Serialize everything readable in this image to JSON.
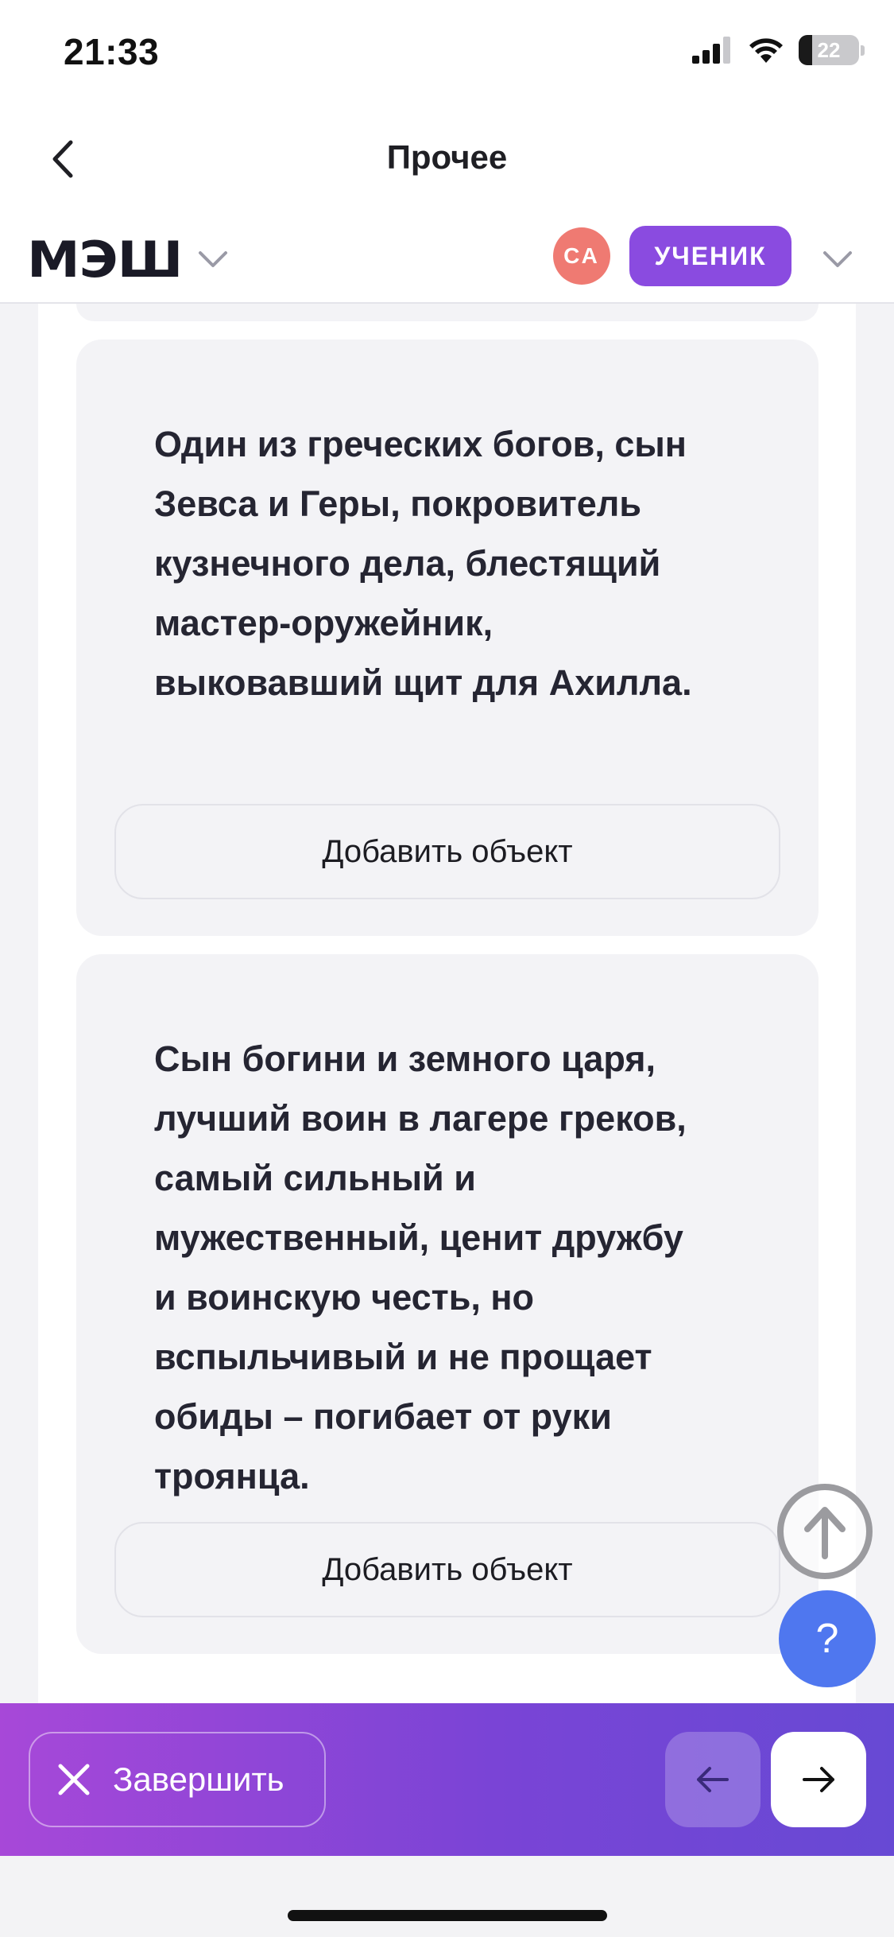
{
  "status_bar": {
    "time": "21:33",
    "battery_level": "22",
    "icons": [
      "cellular-signal-icon",
      "wifi-icon",
      "battery-icon"
    ]
  },
  "header": {
    "title": "Прочее",
    "back_icon": "chevron-left-icon"
  },
  "brand_bar": {
    "logo": "МЭШ",
    "avatar_initials": "СА",
    "role": "УЧЕНИК",
    "colors": {
      "avatar": "#ef7a72",
      "role_badge": "#8a4be0"
    }
  },
  "cards": [
    {
      "text": "Один из греческих богов, сын Зевса и Геры, покровитель кузнечного дела, блестящий мастер-оружейник, выковавший щит для Ахилла.",
      "button_label": "Добавить объект"
    },
    {
      "text": "Сын богини и земного царя, лучший воин в лагере греков, самый сильный и мужественный, ценит дружбу и воинскую честь, но вспыльчивый и не прощает обиды – погибает от руки троянца.",
      "button_label": "Добавить объект"
    }
  ],
  "floating": {
    "scroll_top_icon": "arrow-up-circle-icon",
    "help_label": "?"
  },
  "action_bar": {
    "finish_label": "Завершить",
    "colors": {
      "gradient_start": "#a748d8",
      "gradient_end": "#6749d4"
    }
  }
}
